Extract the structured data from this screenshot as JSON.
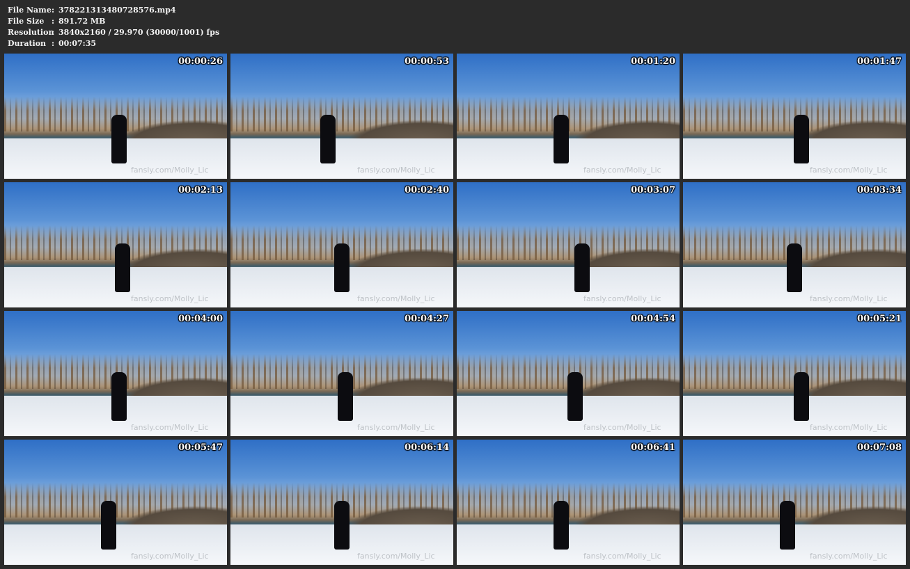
{
  "file_info": {
    "name_label": "File Name",
    "name_value": "378221313480728576.mp4",
    "size_label": "File Size",
    "size_value": "891.72 MB",
    "resolution_label": "Resolution",
    "resolution_value": "3840x2160 / 29.970 (30000/1001) fps",
    "duration_label": "Duration",
    "duration_value": "00:07:35",
    "separator": ":"
  },
  "thumbnails": [
    {
      "timestamp": "00:00:26",
      "watermark": "fansly.com/Molly_Lic"
    },
    {
      "timestamp": "00:00:53",
      "watermark": "fansly.com/Molly_Lic"
    },
    {
      "timestamp": "00:01:20",
      "watermark": "fansly.com/Molly_Lic"
    },
    {
      "timestamp": "00:01:47",
      "watermark": "fansly.com/Molly_Lic"
    },
    {
      "timestamp": "00:02:13",
      "watermark": "fansly.com/Molly_Lic"
    },
    {
      "timestamp": "00:02:40",
      "watermark": "fansly.com/Molly_Lic"
    },
    {
      "timestamp": "00:03:07",
      "watermark": "fansly.com/Molly_Lic"
    },
    {
      "timestamp": "00:03:34",
      "watermark": "fansly.com/Molly_Lic"
    },
    {
      "timestamp": "00:04:00",
      "watermark": "fansly.com/Molly_Lic"
    },
    {
      "timestamp": "00:04:27",
      "watermark": "fansly.com/Molly_Lic"
    },
    {
      "timestamp": "00:04:54",
      "watermark": "fansly.com/Molly_Lic"
    },
    {
      "timestamp": "00:05:21",
      "watermark": "fansly.com/Molly_Lic"
    },
    {
      "timestamp": "00:05:47",
      "watermark": "fansly.com/Molly_Lic"
    },
    {
      "timestamp": "00:06:14",
      "watermark": "fansly.com/Molly_Lic"
    },
    {
      "timestamp": "00:06:41",
      "watermark": "fansly.com/Molly_Lic"
    },
    {
      "timestamp": "00:07:08",
      "watermark": "fansly.com/Molly_Lic"
    }
  ]
}
